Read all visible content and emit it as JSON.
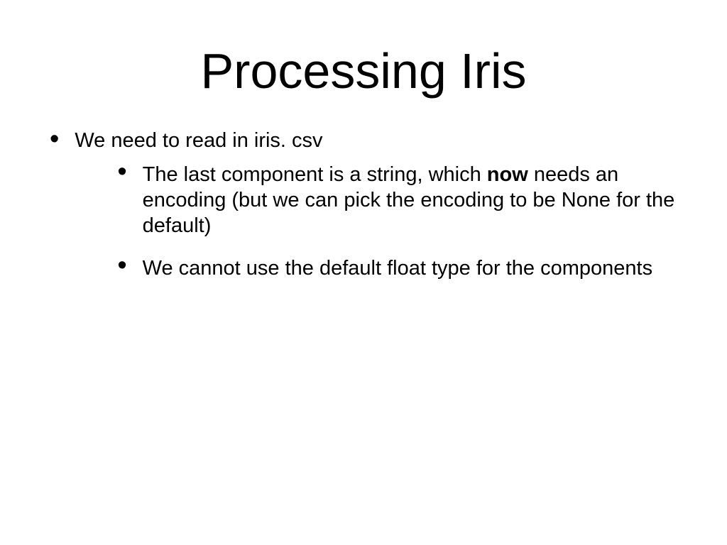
{
  "title": "Processing Iris",
  "bullets": [
    {
      "text": "We need to read in iris. csv",
      "children": [
        {
          "pre": "The last component is a string, which ",
          "bold": "now",
          "post": " needs an encoding (but we can pick the encoding to be None for the default)"
        },
        {
          "pre": "We cannot use the default float type for the components",
          "bold": "",
          "post": ""
        }
      ]
    }
  ]
}
